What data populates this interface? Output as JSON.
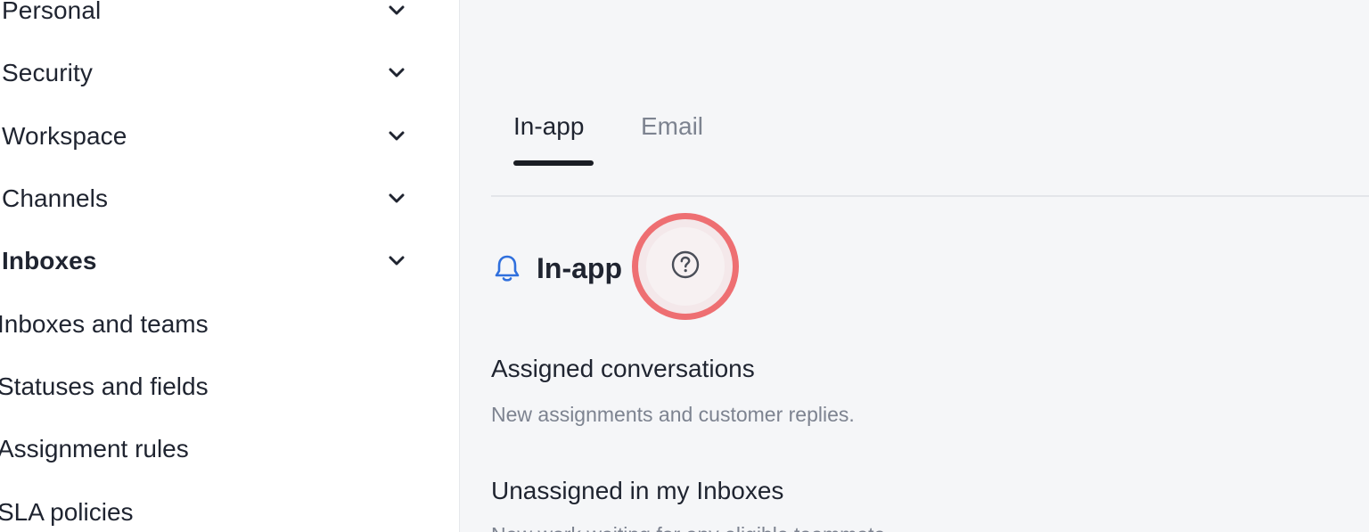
{
  "sidebar": {
    "items": [
      {
        "label": "Personal"
      },
      {
        "label": "Security"
      },
      {
        "label": "Workspace"
      },
      {
        "label": "Channels"
      },
      {
        "label": "Inboxes"
      }
    ],
    "sub_items": [
      {
        "label": "Inboxes and teams"
      },
      {
        "label": "Statuses and fields"
      },
      {
        "label": "Assignment rules"
      },
      {
        "label": "SLA policies"
      }
    ]
  },
  "tabs": [
    {
      "label": "In-app"
    },
    {
      "label": "Email"
    }
  ],
  "section": {
    "title": "In-app",
    "icon": "bell-icon",
    "help_icon": "question-circle-icon"
  },
  "settings": [
    {
      "title": "Assigned conversations",
      "description": "New assignments and customer replies."
    },
    {
      "title": "Unassigned in my Inboxes",
      "description": "New work waiting for any eligible teammate."
    }
  ],
  "colors": {
    "accent": "#2f6fdd",
    "highlight_ring": "#ee6f72"
  }
}
